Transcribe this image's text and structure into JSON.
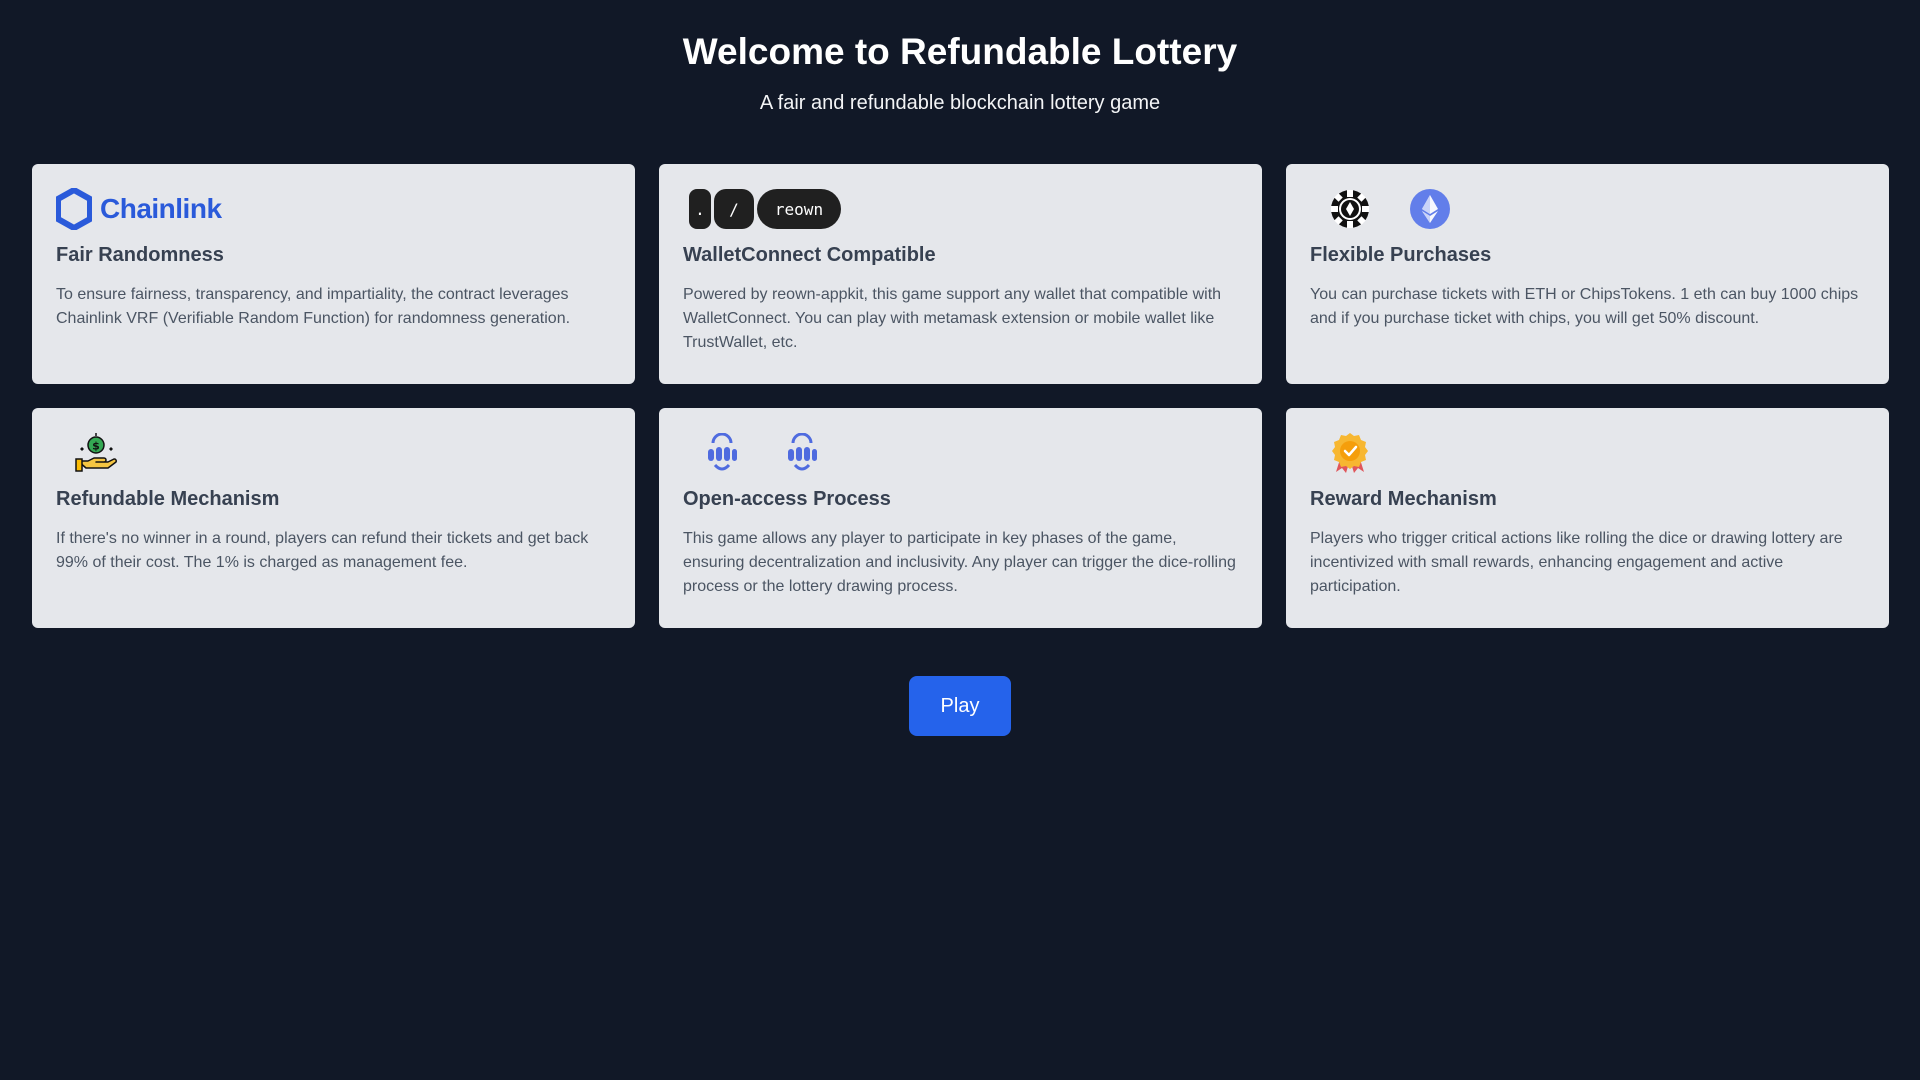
{
  "hero": {
    "title": "Welcome to Refundable Lottery",
    "subtitle": "A fair and refundable blockchain lottery game"
  },
  "cards": [
    {
      "title": "Fair Randomness",
      "text": "To ensure fairness, transparency, and impartiality, the contract leverages Chainlink VRF (Verifiable Random Function) for randomness generation.",
      "logo_text": "Chainlink",
      "icons": [
        "chainlink-logo"
      ]
    },
    {
      "title": "WalletConnect Compatible",
      "text": "Powered by reown-appkit, this game support any wallet that compatible with WalletConnect. You can play with metamask extension or mobile wallet like TrustWallet, etc.",
      "logo_keys": [
        ".",
        "/",
        "reown"
      ],
      "icons": [
        "reown-logo"
      ]
    },
    {
      "title": "Flexible Purchases",
      "text": "You can purchase tickets with ETH or ChipsTokens. 1 eth can buy 1000 chips and if you purchase ticket with chips, you will get 50% discount.",
      "icons": [
        "poker-chip-icon",
        "ethereum-icon"
      ]
    },
    {
      "title": "Refundable Mechanism",
      "text": "If there's no winner in a round, players can refund their tickets and get back 99% of their cost. The 1% is charged as management fee.",
      "icons": [
        "money-hand-icon"
      ]
    },
    {
      "title": "Open-access Process",
      "text": "This game allows any player to participate in key phases of the game, ensuring decentralization and inclusivity. Any player can trigger the dice-rolling process or the lottery drawing process.",
      "icons": [
        "hand-tap-icon",
        "hand-tap-icon"
      ]
    },
    {
      "title": "Reward Mechanism",
      "text": "Players who trigger critical actions like rolling the dice or drawing lottery are incentivized with small rewards, enhancing engagement and active participation.",
      "icons": [
        "award-badge-icon"
      ]
    }
  ],
  "play_button": {
    "label": "Play"
  },
  "colors": {
    "background": "#111827",
    "card": "#e5e7eb",
    "accent": "#2563eb",
    "chainlink": "#2a5ada",
    "ethereum": "#627eea"
  }
}
